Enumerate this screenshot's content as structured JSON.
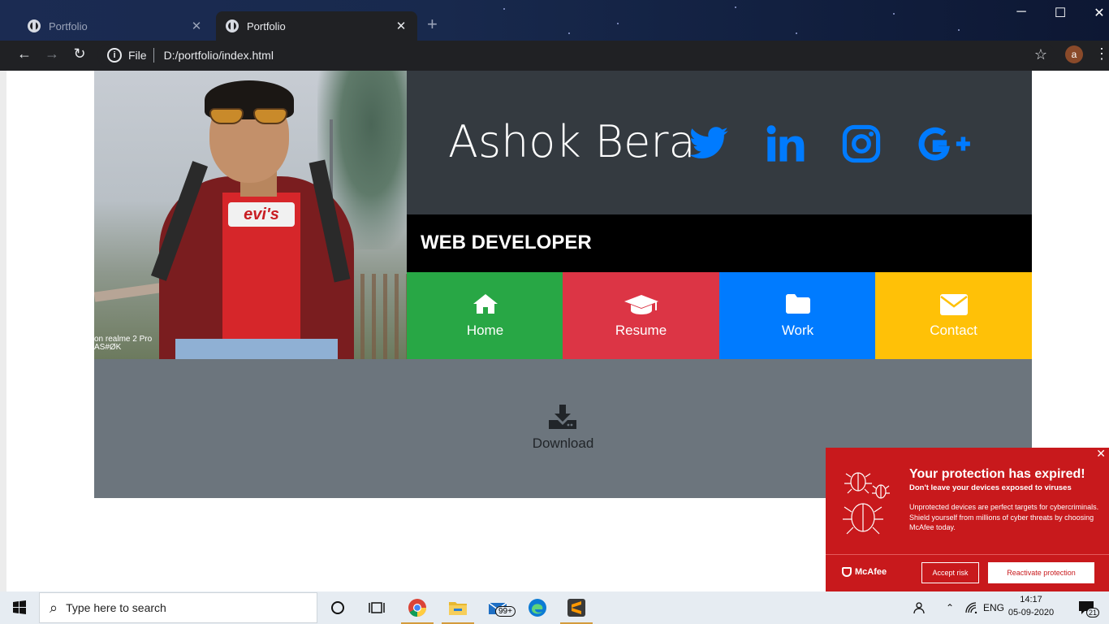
{
  "browser": {
    "tabs": [
      {
        "title": "Portfolio",
        "active": false
      },
      {
        "title": "Portfolio",
        "active": true
      }
    ],
    "new_tab": "+",
    "url_scheme_label": "File",
    "url": "D:/portfolio/index.html",
    "profile_initial": "a",
    "window_controls": {
      "minimize": "─",
      "maximize": "☐",
      "close": "✕"
    }
  },
  "profile": {
    "name": "Ashok Bera",
    "role": "WEB DEVELOPER",
    "photo_watermark_line1": "on realme 2 Pro",
    "photo_watermark_line2": "AS#ØK",
    "photo_shirt_logo": "evi's",
    "social_icons": [
      "twitter-icon",
      "linkedin-icon",
      "instagram-icon",
      "google-plus-icon"
    ]
  },
  "nav": [
    {
      "label": "Home",
      "icon": "home-icon",
      "color": "#28a745"
    },
    {
      "label": "Resume",
      "icon": "graduation-cap-icon",
      "color": "#dc3545"
    },
    {
      "label": "Work",
      "icon": "folder-icon",
      "color": "#007bff"
    },
    {
      "label": "Contact",
      "icon": "envelope-icon",
      "color": "#ffc107"
    }
  ],
  "footer": {
    "download_label": "Download",
    "icon": "download-icon"
  },
  "colors": {
    "header_bg": "#343a40",
    "social": "#007bff",
    "footer_bg": "#6c757d",
    "mcafee_red": "#c8191c"
  },
  "mcafee": {
    "close": "✕",
    "title": "Your protection has expired!",
    "subtitle": "Don't leave your devices exposed to viruses",
    "body": "Unprotected devices are perfect targets for cybercriminals. Shield yourself from millions of cyber threats by choosing McAfee today.",
    "brand": "McAfee",
    "accept": "Accept risk",
    "reactivate": "Reactivate protection"
  },
  "taskbar": {
    "search_placeholder": "Type here to search",
    "mail_badge": "99+",
    "language": "ENG",
    "time": "14:17",
    "date": "05-09-2020",
    "notifications": "21"
  }
}
